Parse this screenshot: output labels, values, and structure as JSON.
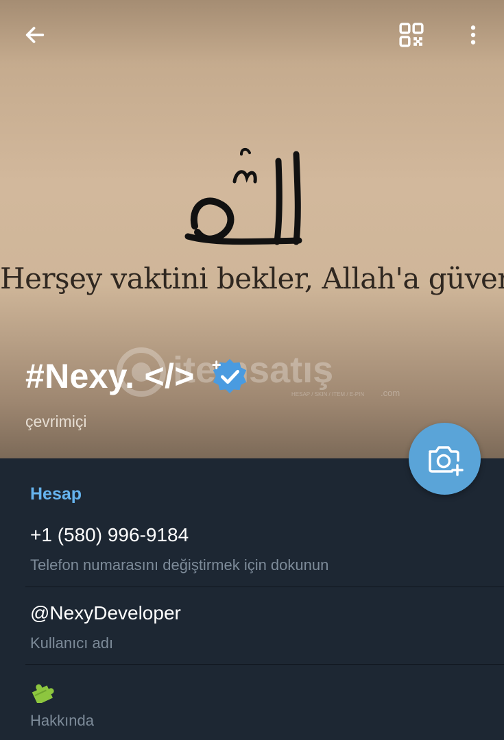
{
  "header": {
    "photo_caption": "Herşey vaktini bekler, Allah'a güven",
    "watermark_text": "itemsatış",
    "watermark_tagline": "HESAP / SKIN / ITEM / E-PIN",
    "watermark_domain": ".com",
    "profile_name": "#Nexy. </>",
    "status": "çevrimiçi",
    "icons": {
      "back": "arrow-left-icon",
      "qr": "qr-code-icon",
      "menu": "more-vertical-icon",
      "badge": "verified-badge-icon",
      "camera": "camera-add-icon"
    }
  },
  "account": {
    "section_title": "Hesap",
    "phone": "+1 (580) 996-9184",
    "phone_hint": "Telefon numarasını değiştirmek için dokunun",
    "username": "@NexyDeveloper",
    "username_hint": "Kullanıcı adı",
    "about_emoji": "puzzle-piece-icon",
    "about_label": "Hakkında"
  },
  "colors": {
    "accent": "#66b4ee",
    "fab": "#5aa4d8",
    "background": "#1d2733",
    "badge": "#4a9be0"
  }
}
